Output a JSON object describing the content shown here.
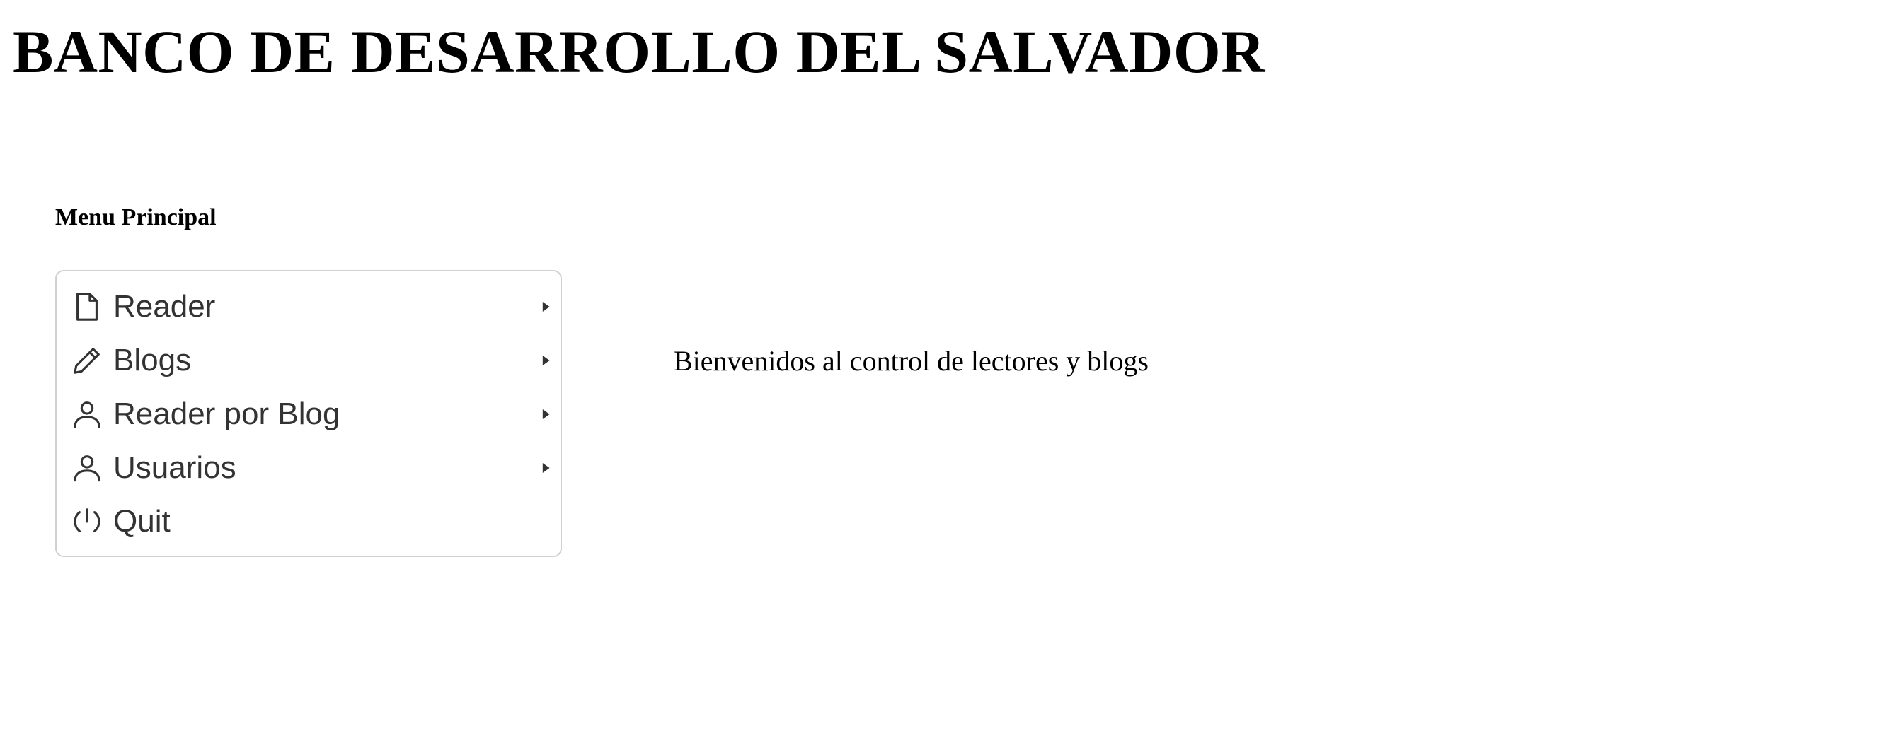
{
  "header": {
    "title": "BANCO DE DESARROLLO DEL SALVADOR"
  },
  "menu": {
    "heading": "Menu Principal",
    "items": [
      {
        "label": "Reader",
        "icon": "file-icon",
        "has_submenu": true
      },
      {
        "label": "Blogs",
        "icon": "pencil-icon",
        "has_submenu": true
      },
      {
        "label": "Reader por Blog",
        "icon": "user-icon",
        "has_submenu": true
      },
      {
        "label": "Usuarios",
        "icon": "user-icon",
        "has_submenu": true
      },
      {
        "label": "Quit",
        "icon": "power-icon",
        "has_submenu": false
      }
    ]
  },
  "main": {
    "welcome_text": "Bienvenidos al control de lectores y blogs"
  },
  "colors": {
    "menu_text": "#333333",
    "menu_border": "#d0d0d0",
    "background": "#ffffff"
  }
}
